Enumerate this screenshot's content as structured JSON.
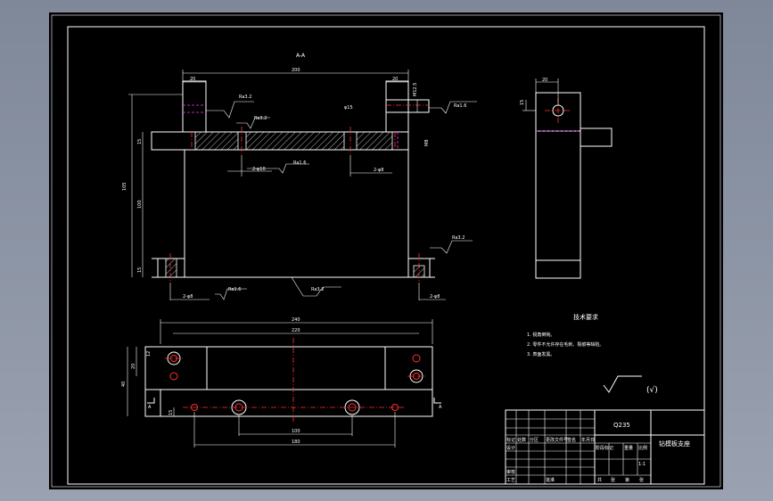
{
  "section_label": "A-A",
  "front_view": {
    "dims": {
      "overall_width": "200",
      "left_boss": "20",
      "right_boss": "20",
      "height_total": "105",
      "height_inner": "100",
      "base_thk": "15",
      "top_thk": "15",
      "bore_dia": "φ15",
      "side_dim": "M12.5"
    },
    "roughness": {
      "r1": "Ra3.2",
      "r2": "Ra3.2",
      "r3": "Ra1.6",
      "r4": "Ra1.6",
      "r5": "Ra3.2",
      "r6": "Ra3.2",
      "r7": "Ra1.6"
    },
    "hole_notes": {
      "n1": "2-φ10",
      "n2": "2-φ8",
      "n3": "2-φ8",
      "n4": "2-φ8"
    },
    "thread_note": "M8"
  },
  "side_view": {
    "dims": {
      "width": "20",
      "height": "15"
    }
  },
  "plan_view": {
    "dims": {
      "overall": "240",
      "inner": "220",
      "hole_pitch": "100",
      "hole_span": "180",
      "depth": "40",
      "row": "20",
      "edge_a": "15",
      "edge_b": "12"
    },
    "section_marks": [
      "A",
      "A"
    ]
  },
  "tech_requirements": {
    "title": "技术要求",
    "items": [
      "1. 锐角倒钝。",
      "2. 零件不允许存在毛刺、裂痕等缺陷。",
      "3. 表面发黑。"
    ]
  },
  "roughness_symbol_note": "(√)",
  "title_block": {
    "material": "Q235",
    "part_name": "钻模板支座",
    "labels": [
      "标记",
      "处数",
      "分区",
      "更改文件号",
      "签名",
      "年月日"
    ],
    "row_labels": [
      "设计",
      "审核",
      "工艺"
    ],
    "right_labels": [
      "阶段标记",
      "重量",
      "比例"
    ],
    "bottom_labels": [
      "共",
      "张",
      "第",
      "张"
    ],
    "approve": "批准",
    "scale": "1:1"
  }
}
